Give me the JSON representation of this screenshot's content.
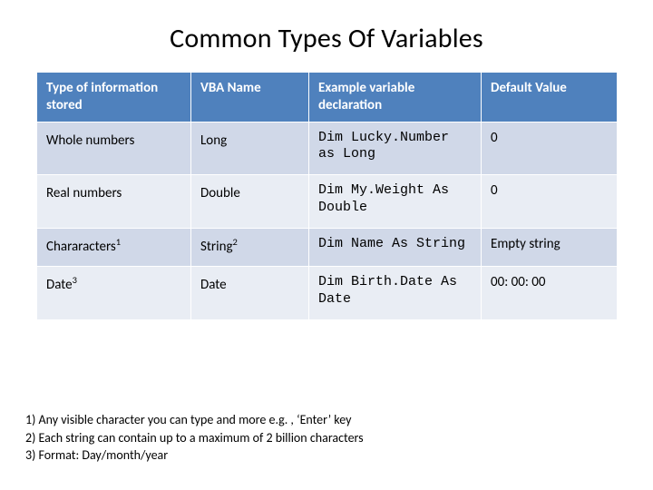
{
  "title": "Common Types Of Variables",
  "columns": {
    "c0": "Type of information stored",
    "c1": "VBA Name",
    "c2": "Example variable declaration",
    "c3": "Default Value"
  },
  "rows": [
    {
      "type": "Whole numbers",
      "type_sup": "",
      "vba": "Long",
      "vba_sup": "",
      "example": "Dim Lucky.Number as Long",
      "default": "0"
    },
    {
      "type": "Real numbers",
      "type_sup": "",
      "vba": "Double",
      "vba_sup": "",
      "example": "Dim My.Weight As Double",
      "default": "0"
    },
    {
      "type": "Chararacters",
      "type_sup": "1",
      "vba": "String",
      "vba_sup": "2",
      "example": "Dim Name As String",
      "default": "Empty string"
    },
    {
      "type": "Date",
      "type_sup": "3",
      "vba": "Date",
      "vba_sup": "",
      "example": "Dim Birth.Date As Date",
      "default": "00: 00: 00"
    }
  ],
  "footnotes": {
    "f1": "1) Any visible character you can type and more e.g. , ‘Enter’ key",
    "f2": "2) Each string can contain up to a maximum of 2 billion characters",
    "f3": "3) Format: Day/month/year"
  }
}
